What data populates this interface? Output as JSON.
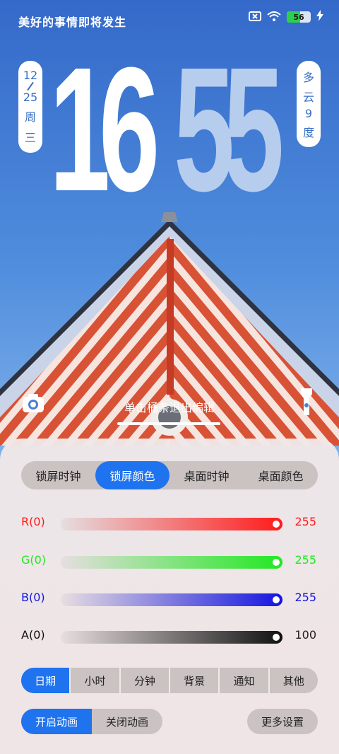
{
  "status_bar": {
    "motto": "美好的事情即将发生",
    "battery_level": "56",
    "battery_fraction": 0.56,
    "icons": [
      "sim-off-icon",
      "wifi-icon",
      "battery-icon",
      "charging-icon"
    ]
  },
  "lockscreen": {
    "date_month": "12",
    "date_day": "25",
    "weekday_a": "周",
    "weekday_b": "三",
    "clock_hours": "16",
    "clock_minutes": "55",
    "weather_a": "多",
    "weather_b": "云",
    "temp_a": "9",
    "temp_b": "度",
    "edit_hint": "单击桶条退出编辑"
  },
  "panel": {
    "tabs": [
      {
        "label": "锁屏时钟",
        "active": false
      },
      {
        "label": "锁屏颜色",
        "active": true
      },
      {
        "label": "桌面时钟",
        "active": false
      },
      {
        "label": "桌面颜色",
        "active": false
      }
    ],
    "sliders": [
      {
        "label": "R(0)",
        "value": "255",
        "color": "#ff1a1a"
      },
      {
        "label": "G(0)",
        "value": "255",
        "color": "#22e822"
      },
      {
        "label": "B(0)",
        "value": "255",
        "color": "#1515e0"
      },
      {
        "label": "A(0)",
        "value": "100",
        "color": "#111111"
      }
    ],
    "segments": [
      {
        "label": "日期",
        "active": true
      },
      {
        "label": "小时",
        "active": false
      },
      {
        "label": "分钟",
        "active": false
      },
      {
        "label": "背景",
        "active": false
      },
      {
        "label": "通知",
        "active": false
      },
      {
        "label": "其他",
        "active": false
      }
    ],
    "animation": {
      "on_label": "开启动画",
      "off_label": "关闭动画"
    },
    "more_label": "更多设置"
  },
  "colors": {
    "accent": "#1f73ee",
    "date_text": "#3a6fc6",
    "minutes": "#b7cdee"
  }
}
